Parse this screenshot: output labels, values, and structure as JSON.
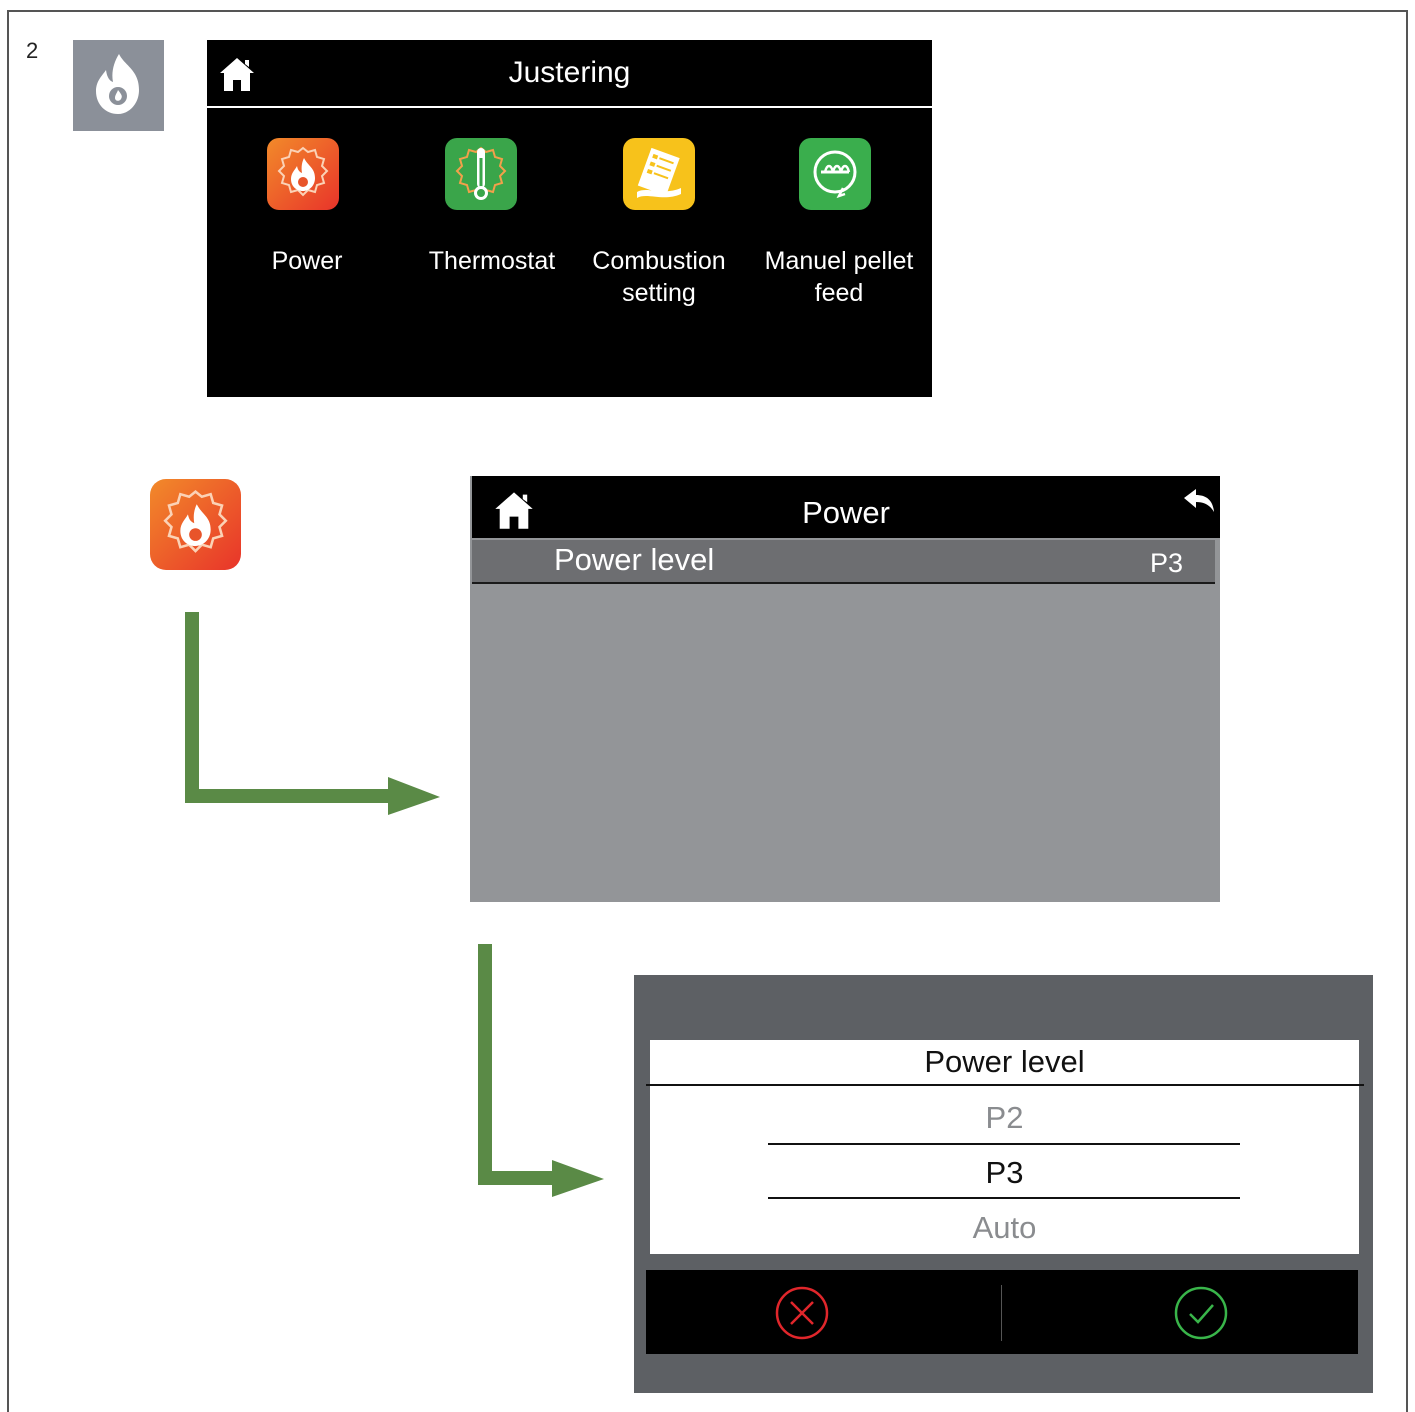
{
  "step": {
    "number": "2"
  },
  "screen1": {
    "title": "Justering",
    "items": [
      {
        "label": "Power",
        "icon": "power-settings-icon",
        "color": "#e8542a"
      },
      {
        "label": "Thermostat",
        "icon": "thermostat-settings-icon",
        "color": "#3aa54a"
      },
      {
        "label": "Combustion\nsetting",
        "icon": "combustion-settings-icon",
        "color": "#f7c21b"
      },
      {
        "label": "Manuel pellet\nfeed",
        "icon": "pellet-feed-icon",
        "color": "#3aae4d"
      }
    ]
  },
  "screen2": {
    "title": "Power",
    "row": {
      "label": "Power level",
      "value": "P3"
    }
  },
  "dialog": {
    "title": "Power level",
    "options": [
      "P2",
      "P3",
      "Auto"
    ],
    "selected": "P3",
    "cancel_icon": "cancel-x-icon",
    "confirm_icon": "confirm-check-icon"
  },
  "colors": {
    "arrow": "#5a8a46",
    "screen_bg": "#000000",
    "menu_bg": "#939598",
    "row_bg": "#6d6e71",
    "cancel": "#e0262b",
    "confirm": "#39b54a"
  }
}
